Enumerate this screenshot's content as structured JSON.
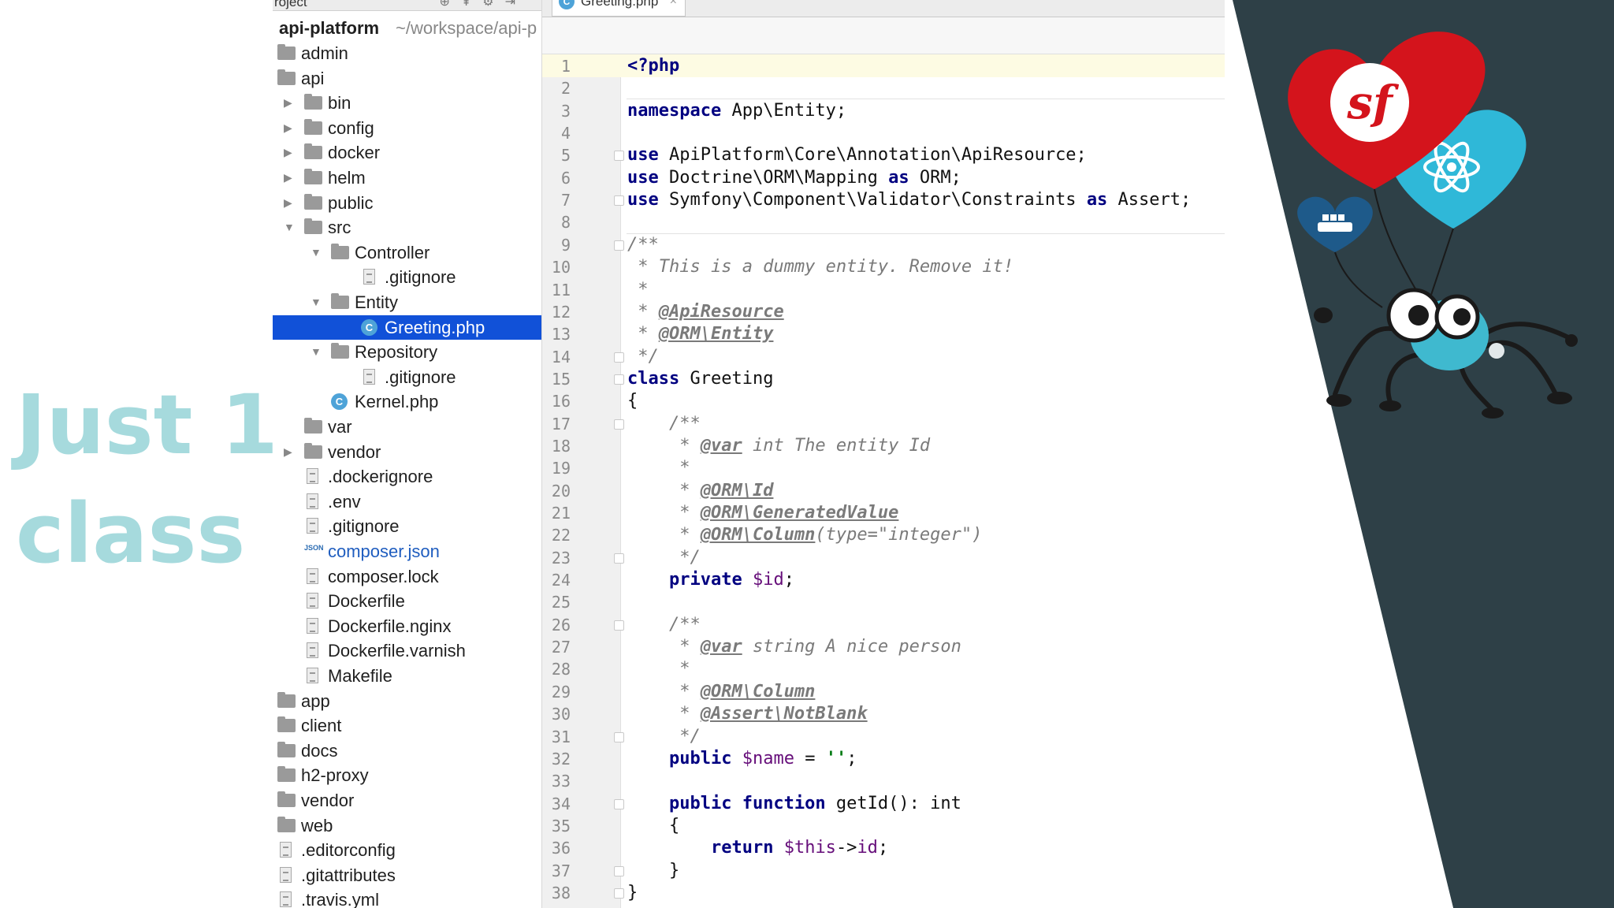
{
  "slide": {
    "title_line1": "Just 1",
    "title_line2": "class",
    "title_color": "#a6dadd"
  },
  "project_panel": {
    "header": "roject",
    "root_name": "api-platform",
    "root_path": "~/workspace/api-p",
    "items": [
      {
        "label": "admin",
        "type": "folder",
        "depth": 0,
        "arrow": ""
      },
      {
        "label": "api",
        "type": "folder",
        "depth": 0,
        "arrow": ""
      },
      {
        "label": "bin",
        "type": "folder",
        "depth": 1,
        "arrow": "▶"
      },
      {
        "label": "config",
        "type": "folder",
        "depth": 1,
        "arrow": "▶"
      },
      {
        "label": "docker",
        "type": "folder",
        "depth": 1,
        "arrow": "▶"
      },
      {
        "label": "helm",
        "type": "folder",
        "depth": 1,
        "arrow": "▶"
      },
      {
        "label": "public",
        "type": "folder",
        "depth": 1,
        "arrow": "▶"
      },
      {
        "label": "src",
        "type": "folder",
        "depth": 1,
        "arrow": "▼"
      },
      {
        "label": "Controller",
        "type": "folder",
        "depth": 2,
        "arrow": "▼"
      },
      {
        "label": ".gitignore",
        "type": "file",
        "depth": 3,
        "arrow": ""
      },
      {
        "label": "Entity",
        "type": "folder",
        "depth": 2,
        "arrow": "▼"
      },
      {
        "label": "Greeting.php",
        "type": "class",
        "depth": 3,
        "arrow": "",
        "selected": true
      },
      {
        "label": "Repository",
        "type": "folder",
        "depth": 2,
        "arrow": "▼"
      },
      {
        "label": ".gitignore",
        "type": "file",
        "depth": 3,
        "arrow": ""
      },
      {
        "label": "Kernel.php",
        "type": "class",
        "depth": 2,
        "arrow": ""
      },
      {
        "label": "var",
        "type": "folder",
        "depth": 1,
        "arrow": ""
      },
      {
        "label": "vendor",
        "type": "folder",
        "depth": 1,
        "arrow": "▶"
      },
      {
        "label": ".dockerignore",
        "type": "file",
        "depth": 1,
        "arrow": ""
      },
      {
        "label": ".env",
        "type": "file",
        "depth": 1,
        "arrow": ""
      },
      {
        "label": ".gitignore",
        "type": "file",
        "depth": 1,
        "arrow": ""
      },
      {
        "label": "composer.json",
        "type": "json",
        "depth": 1,
        "arrow": ""
      },
      {
        "label": "composer.lock",
        "type": "file",
        "depth": 1,
        "arrow": ""
      },
      {
        "label": "Dockerfile",
        "type": "file",
        "depth": 1,
        "arrow": ""
      },
      {
        "label": "Dockerfile.nginx",
        "type": "file",
        "depth": 1,
        "arrow": ""
      },
      {
        "label": "Dockerfile.varnish",
        "type": "file",
        "depth": 1,
        "arrow": ""
      },
      {
        "label": "Makefile",
        "type": "file",
        "depth": 1,
        "arrow": ""
      },
      {
        "label": "app",
        "type": "folder",
        "depth": 0,
        "arrow": ""
      },
      {
        "label": "client",
        "type": "folder",
        "depth": 0,
        "arrow": ""
      },
      {
        "label": "docs",
        "type": "folder",
        "depth": 0,
        "arrow": ""
      },
      {
        "label": "h2-proxy",
        "type": "folder",
        "depth": 0,
        "arrow": ""
      },
      {
        "label": "vendor",
        "type": "folder",
        "depth": 0,
        "arrow": ""
      },
      {
        "label": "web",
        "type": "folder",
        "depth": 0,
        "arrow": ""
      },
      {
        "label": ".editorconfig",
        "type": "file",
        "depth": 0,
        "arrow": ""
      },
      {
        "label": ".gitattributes",
        "type": "file",
        "depth": 0,
        "arrow": ""
      },
      {
        "label": ".travis.yml",
        "type": "file",
        "depth": 0,
        "arrow": ""
      }
    ]
  },
  "editor": {
    "tab_label": "Greeting.php",
    "tab_icon": "class-icon",
    "lines": [
      [
        [
          "ph",
          "<?php"
        ]
      ],
      [],
      [
        [
          "kw",
          "namespace"
        ],
        [
          "t",
          " App\\Entity;"
        ]
      ],
      [],
      [
        [
          "kw",
          "use"
        ],
        [
          "t",
          " ApiPlatform\\Core\\Annotation\\ApiResource;"
        ]
      ],
      [
        [
          "kw",
          "use"
        ],
        [
          "t",
          " Doctrine\\ORM\\Mapping "
        ],
        [
          "kw",
          "as"
        ],
        [
          "t",
          " ORM;"
        ]
      ],
      [
        [
          "kw",
          "use"
        ],
        [
          "t",
          " Symfony\\Component\\Validator\\Constraints "
        ],
        [
          "kw",
          "as"
        ],
        [
          "t",
          " Assert;"
        ]
      ],
      [],
      [
        [
          "cm",
          "/**"
        ]
      ],
      [
        [
          "cm",
          " * This is a dummy entity. Remove it!"
        ]
      ],
      [
        [
          "cm",
          " *"
        ]
      ],
      [
        [
          "cm",
          " * "
        ],
        [
          "tag",
          "@ApiResource"
        ]
      ],
      [
        [
          "cm",
          " * "
        ],
        [
          "tag",
          "@ORM\\Entity"
        ]
      ],
      [
        [
          "cm",
          " */"
        ]
      ],
      [
        [
          "kw",
          "class"
        ],
        [
          "t",
          " Greeting"
        ]
      ],
      [
        [
          "t",
          "{"
        ]
      ],
      [
        [
          "cm",
          "    /**"
        ]
      ],
      [
        [
          "cm",
          "     * "
        ],
        [
          "tag",
          "@var"
        ],
        [
          "cm",
          " int The entity Id"
        ]
      ],
      [
        [
          "cm",
          "     *"
        ]
      ],
      [
        [
          "cm",
          "     * "
        ],
        [
          "tag",
          "@ORM\\Id"
        ]
      ],
      [
        [
          "cm",
          "     * "
        ],
        [
          "tag",
          "@ORM\\GeneratedValue"
        ]
      ],
      [
        [
          "cm",
          "     * "
        ],
        [
          "tag",
          "@ORM\\Column"
        ],
        [
          "cm",
          "(type=\"integer\")"
        ]
      ],
      [
        [
          "cm",
          "     */"
        ]
      ],
      [
        [
          "t",
          "    "
        ],
        [
          "kw",
          "private"
        ],
        [
          "t",
          " "
        ],
        [
          "var",
          "$id"
        ],
        [
          "t",
          ";"
        ]
      ],
      [],
      [
        [
          "cm",
          "    /**"
        ]
      ],
      [
        [
          "cm",
          "     * "
        ],
        [
          "tag",
          "@var"
        ],
        [
          "cm",
          " string A nice person"
        ]
      ],
      [
        [
          "cm",
          "     *"
        ]
      ],
      [
        [
          "cm",
          "     * "
        ],
        [
          "tag",
          "@ORM\\Column"
        ]
      ],
      [
        [
          "cm",
          "     * "
        ],
        [
          "tag",
          "@Assert\\NotBlank"
        ]
      ],
      [
        [
          "cm",
          "     */"
        ]
      ],
      [
        [
          "t",
          "    "
        ],
        [
          "kw",
          "public"
        ],
        [
          "t",
          " "
        ],
        [
          "var",
          "$name"
        ],
        [
          "t",
          " = "
        ],
        [
          "str",
          "''"
        ],
        [
          "t",
          ";"
        ]
      ],
      [],
      [
        [
          "t",
          "    "
        ],
        [
          "kw",
          "public function"
        ],
        [
          "t",
          " getId(): int"
        ]
      ],
      [
        [
          "t",
          "    {"
        ]
      ],
      [
        [
          "t",
          "        "
        ],
        [
          "kw",
          "return"
        ],
        [
          "t",
          " "
        ],
        [
          "var",
          "$this"
        ],
        [
          "t",
          "->"
        ],
        [
          "var",
          "id"
        ],
        [
          "t",
          ";"
        ]
      ],
      [
        [
          "t",
          "    }"
        ]
      ],
      [
        [
          "t",
          "}"
        ]
      ]
    ],
    "fold_lines": [
      5,
      7,
      9,
      14,
      15,
      17,
      23,
      26,
      31,
      34,
      37,
      38
    ]
  },
  "decoration": {
    "balloon_symfony": "sf",
    "colors": {
      "panel": "#2e4047",
      "heart_red": "#d4141c",
      "heart_blue": "#2fb8d8",
      "spider_body": "#3fb9cf",
      "docker_blue": "#2b6aa0"
    }
  }
}
